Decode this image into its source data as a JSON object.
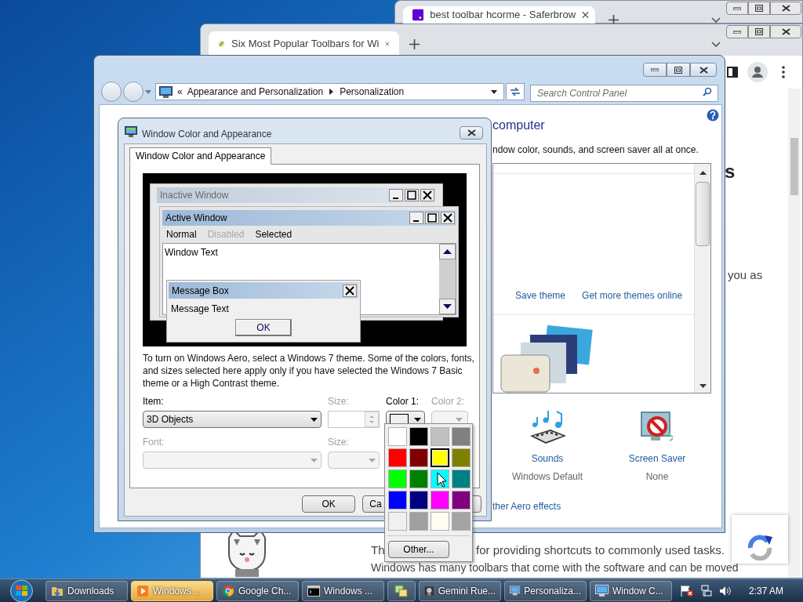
{
  "back_browser": {
    "tab": {
      "title": "best toolbar hcorme - Saferbrow"
    }
  },
  "browser": {
    "tab": {
      "title": "Six Most Popular Toolbars for Wi"
    },
    "heading_fragment": "s",
    "paragraph_fragment": "you as",
    "line_start": "Th",
    "line_end": "for providing shortcuts to commonly used tasks.",
    "next_line": "Windows has many toolbars that come with the software and can be moved"
  },
  "control_panel": {
    "address": {
      "overflow": "«",
      "path": [
        "Appearance and Personalization",
        "Personalization"
      ]
    },
    "search": {
      "placeholder": "Search Control Panel"
    },
    "heading": "computer",
    "subtitle": "ndow color, sounds, and screen saver all at once.",
    "theme_links": [
      "Save theme",
      "Get more themes online"
    ],
    "settings": [
      {
        "kind": "sounds",
        "label": "Sounds",
        "value": "Windows Default"
      },
      {
        "kind": "screensaver",
        "label": "Screen Saver",
        "value": "None"
      }
    ],
    "link": "ther Aero effects"
  },
  "dialog": {
    "title": "Window Color and Appearance",
    "tabs": [
      {
        "label": "Window Color and Appearance",
        "selected": true
      }
    ],
    "preview": {
      "inactive_title": "Inactive Window",
      "active_title": "Active Window",
      "menu": [
        {
          "label": "Normal",
          "disabled": false
        },
        {
          "label": "Disabled",
          "disabled": true
        },
        {
          "label": "Selected",
          "disabled": false
        }
      ],
      "window_text": "Window Text",
      "message_box": {
        "title": "Message Box",
        "text": "Message Text",
        "button": "OK"
      }
    },
    "note": "To turn on Windows Aero, select a Windows 7 theme.  Some of the colors, fonts, and sizes selected here apply only if you have selected the Windows 7 Basic theme or a High Contrast theme.",
    "fields": [
      {
        "kind": "dropdown",
        "label": "Item:",
        "value": "3D Objects",
        "disabled": false
      },
      {
        "kind": "spinner",
        "label": "Size:",
        "disabled": true
      },
      {
        "kind": "color",
        "label": "Color 1:",
        "disabled": false
      },
      {
        "kind": "color",
        "label": "Color 2:",
        "disabled": true
      },
      {
        "kind": "dropdown",
        "label": "Font:",
        "disabled": true
      },
      {
        "kind": "dropdown",
        "label": "Size:",
        "disabled": true
      }
    ],
    "buttons": [
      "OK",
      "Ca"
    ]
  },
  "color_picker": {
    "swatches": [
      {
        "color": "#ffffff",
        "selected": false
      },
      {
        "color": "#000000",
        "selected": false
      },
      {
        "color": "#c0c0c0",
        "selected": false
      },
      {
        "color": "#808080",
        "selected": false
      },
      {
        "color": "#ff0000",
        "selected": false
      },
      {
        "color": "#800000",
        "selected": false
      },
      {
        "color": "#ffff00",
        "selected": true
      },
      {
        "color": "#808000",
        "selected": false
      },
      {
        "color": "#00ff00",
        "selected": false
      },
      {
        "color": "#008000",
        "selected": false
      },
      {
        "color": "#00ffff",
        "selected": false
      },
      {
        "color": "#008080",
        "selected": false
      },
      {
        "color": "#0000ff",
        "selected": false
      },
      {
        "color": "#000080",
        "selected": false
      },
      {
        "color": "#ff00ff",
        "selected": false
      },
      {
        "color": "#800080",
        "selected": false
      },
      {
        "color": "#f0f0f0",
        "selected": false
      },
      {
        "color": "#a0a0a0",
        "selected": false
      },
      {
        "color": "#fffbf0",
        "selected": false
      },
      {
        "color": "#a4a4a4",
        "selected": false
      }
    ],
    "button": "Other..."
  },
  "taskbar": {
    "items": [
      {
        "kind": "folder",
        "label": "Downloads",
        "flashing": false
      },
      {
        "kind": "media",
        "label": "Windows ...",
        "flashing": true
      },
      {
        "kind": "chrome",
        "label": "Google Ch...",
        "flashing": false
      },
      {
        "kind": "console",
        "label": "Windows ...",
        "flashing": false
      },
      {
        "kind": "app",
        "flashing": false
      },
      {
        "kind": "game",
        "label": "Gemini Rue...",
        "flashing": false
      },
      {
        "kind": "control-panel",
        "label": "Personaliza...",
        "flashing": false
      },
      {
        "kind": "control-panel",
        "label": "Window C...",
        "flashing": false
      }
    ],
    "clock": "2:37 AM"
  }
}
